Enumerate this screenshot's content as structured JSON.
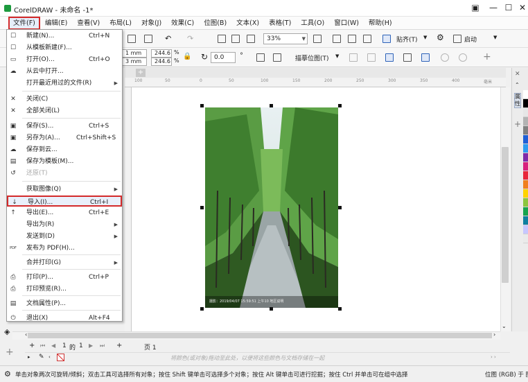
{
  "app": {
    "title": "CorelDRAW - 未命名 -1*",
    "window_buttons": [
      "▣",
      "—",
      "☐",
      "✕"
    ]
  },
  "menubar": {
    "items": [
      "文件(F)",
      "编辑(E)",
      "查看(V)",
      "布局(L)",
      "对象(J)",
      "效果(C)",
      "位图(B)",
      "文本(X)",
      "表格(T)",
      "工具(O)",
      "窗口(W)",
      "帮助(H)"
    ]
  },
  "toolbar": {
    "zoom": "33%",
    "snap_label": "贴齐(T)",
    "launch_label": "启动"
  },
  "propbar": {
    "w_text": "1 mm",
    "h_text": "3 mm",
    "scale_x": "244.6",
    "scale_y": "244.6",
    "percent": "%",
    "angle": "0.0",
    "trace_label": "描摹位图(T)"
  },
  "ruler": {
    "ticks": [
      "100",
      "50",
      "0",
      "50",
      "100",
      "150",
      "200",
      "250",
      "300",
      "350",
      "400"
    ],
    "unit": "毫米"
  },
  "file_menu": {
    "items": [
      {
        "icon": "new-icon",
        "glyph": "☐",
        "label": "新建(N)...",
        "shortcut": "Ctrl+N"
      },
      {
        "icon": "new-from-template-icon",
        "glyph": "☐",
        "label": "从模板新建(F)...",
        "shortcut": ""
      },
      {
        "icon": "open-icon",
        "glyph": "▭",
        "label": "打开(O)...",
        "shortcut": "Ctrl+O"
      },
      {
        "icon": "open-cloud-icon",
        "glyph": "☁",
        "label": "从云中打开...",
        "shortcut": ""
      },
      {
        "icon": "",
        "glyph": "",
        "label": "打开最近用过的文件(R)",
        "shortcut": "",
        "submenu": true
      },
      {
        "icon": "close-icon",
        "glyph": "✕",
        "label": "关闭(C)",
        "shortcut": ""
      },
      {
        "icon": "close-all-icon",
        "glyph": "✕",
        "label": "全部关闭(L)",
        "shortcut": ""
      },
      {
        "icon": "save-icon",
        "glyph": "▣",
        "label": "保存(S)...",
        "shortcut": "Ctrl+S"
      },
      {
        "icon": "save-as-icon",
        "glyph": "▣",
        "label": "另存为(A)...",
        "shortcut": "Ctrl+Shift+S"
      },
      {
        "icon": "save-cloud-icon",
        "glyph": "☁",
        "label": "保存到云...",
        "shortcut": ""
      },
      {
        "icon": "save-template-icon",
        "glyph": "▤",
        "label": "保存为模板(M)...",
        "shortcut": ""
      },
      {
        "icon": "revert-icon",
        "glyph": "↺",
        "label": "还原(T)",
        "shortcut": "",
        "disabled": true
      },
      {
        "icon": "",
        "glyph": "",
        "label": "获取图像(Q)",
        "shortcut": "",
        "submenu": true
      },
      {
        "icon": "import-icon",
        "glyph": "↓",
        "label": "导入(I)...",
        "shortcut": "Ctrl+I",
        "highlight": true
      },
      {
        "icon": "export-icon",
        "glyph": "↑",
        "label": "导出(E)...",
        "shortcut": "Ctrl+E"
      },
      {
        "icon": "",
        "glyph": "",
        "label": "导出为(R)",
        "shortcut": "",
        "submenu": true
      },
      {
        "icon": "",
        "glyph": "",
        "label": "发送到(D)",
        "shortcut": "",
        "submenu": true
      },
      {
        "icon": "pdf-icon",
        "glyph": "PDF",
        "label": "发布为 PDF(H)...",
        "shortcut": ""
      },
      {
        "icon": "",
        "glyph": "",
        "label": "合并打印(G)",
        "shortcut": "",
        "submenu": true
      },
      {
        "icon": "print-icon",
        "glyph": "⎙",
        "label": "打印(P)...",
        "shortcut": "Ctrl+P"
      },
      {
        "icon": "print-preview-icon",
        "glyph": "⎙",
        "label": "打印预览(R)...",
        "shortcut": ""
      },
      {
        "icon": "doc-properties-icon",
        "glyph": "▤",
        "label": "文档属性(P)...",
        "shortcut": ""
      },
      {
        "icon": "exit-icon",
        "glyph": "⏻",
        "label": "退出(X)",
        "shortcut": "Alt+F4"
      }
    ]
  },
  "pages": {
    "current": "1",
    "of_label": "的",
    "total": "1",
    "tab_label": "页 1"
  },
  "colorbar": {
    "hint": "将颜色(或对象)拖动至此处，以便将这些颜色与文档存储在一起"
  },
  "status": {
    "message": "单击对象两次可旋转/倾斜；双击工具可选择所有对象；按住 Shift 键单击可选择多个对象；按住 Alt 键单击可进行挖掘；按住 Ctrl 并单击可在组中选择",
    "right": "位图 (RGB) 于 图"
  },
  "photo": {
    "caption": "摄影：2019/04/07 15:59:51 上午10 地区说明"
  },
  "dock": {
    "tab_label": "属性"
  },
  "colors": {
    "accent_red": "#d42a2a",
    "palette": [
      "#ffffff",
      "#000000",
      "#e6e6e6",
      "#b3b3b3",
      "#808080",
      "#1f5fd6",
      "#2e9bf0",
      "#7e2aa8",
      "#d8217d",
      "#e8253a",
      "#f07f1e",
      "#ffd400",
      "#8cc63f",
      "#16a44e",
      "#0f7fa0",
      "#c7c7ff",
      "#eaeaea"
    ]
  }
}
